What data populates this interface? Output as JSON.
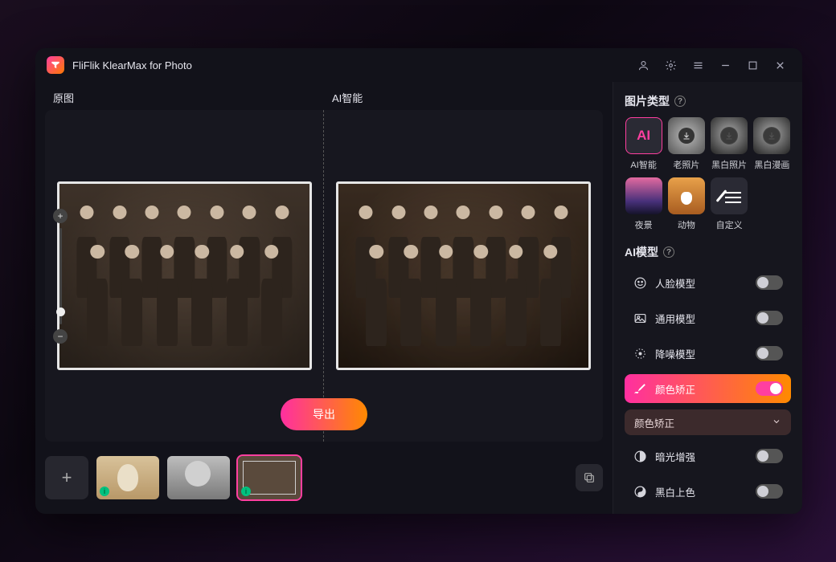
{
  "app": {
    "title": "FliFlik KlearMax for Photo"
  },
  "titlebar_icons": {
    "user": "user-icon",
    "settings": "gear-icon",
    "menu": "menu-icon",
    "minimize": "minimize-icon",
    "maximize": "maximize-icon",
    "close": "close-icon"
  },
  "compare": {
    "left_label": "原图",
    "right_label": "AI智能",
    "export_label": "导出"
  },
  "thumbs": [
    {
      "name": "cat",
      "done": true,
      "selected": false
    },
    {
      "name": "man",
      "done": false,
      "selected": false
    },
    {
      "name": "group",
      "done": true,
      "selected": true
    }
  ],
  "sidebar": {
    "image_type_title": "图片类型",
    "image_types": [
      {
        "key": "ai",
        "label": "AI智能",
        "selected": true,
        "ai_text": "AI"
      },
      {
        "key": "old",
        "label": "老照片",
        "download": true
      },
      {
        "key": "bw",
        "label": "黑白照片",
        "download": true
      },
      {
        "key": "comic",
        "label": "黑白漫画",
        "download": true
      },
      {
        "key": "night",
        "label": "夜景"
      },
      {
        "key": "animal",
        "label": "动物"
      },
      {
        "key": "custom",
        "label": "自定义"
      }
    ],
    "ai_model_title": "AI模型",
    "models": [
      {
        "key": "face",
        "label": "人脸模型",
        "icon": "smile-icon",
        "on": false
      },
      {
        "key": "general",
        "label": "通用模型",
        "icon": "image-icon",
        "on": false
      },
      {
        "key": "denoise",
        "label": "降噪模型",
        "icon": "sparkle-icon",
        "on": false
      },
      {
        "key": "color",
        "label": "颜色矫正",
        "icon": "paint-icon",
        "on": true,
        "active": true
      },
      {
        "key": "dropdown",
        "label": "颜色矫正",
        "is_dropdown": true
      },
      {
        "key": "lowlight",
        "label": "暗光增强",
        "icon": "contrast-icon",
        "on": false
      },
      {
        "key": "colorize",
        "label": "黑白上色",
        "icon": "yin-yang-icon",
        "on": false
      }
    ]
  }
}
